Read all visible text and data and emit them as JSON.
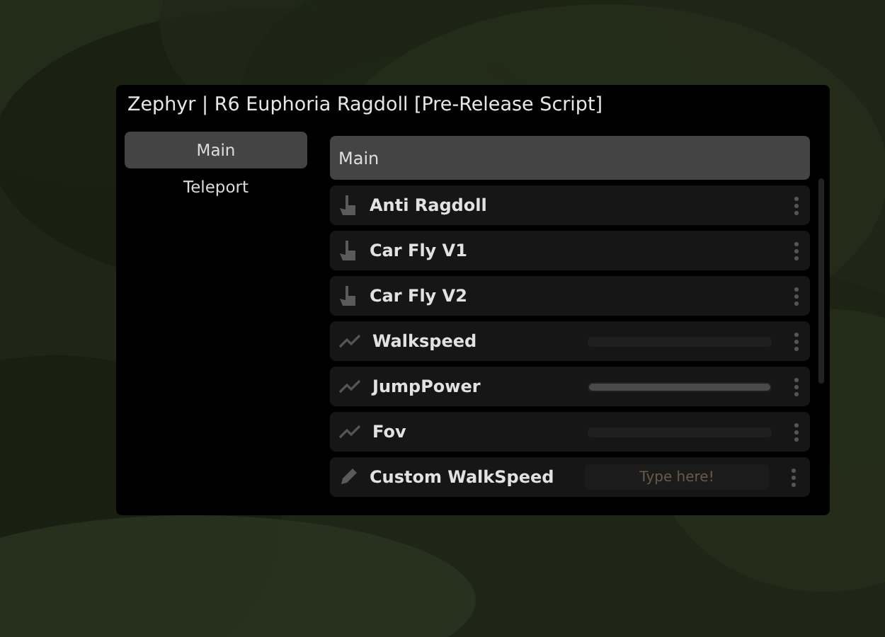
{
  "window": {
    "title": "Zephyr | R6 Euphoria Ragdoll [Pre-Release Script]"
  },
  "tabs": [
    {
      "label": "Main",
      "selected": true
    },
    {
      "label": "Teleport",
      "selected": false
    }
  ],
  "section": {
    "title": "Main"
  },
  "items": [
    {
      "kind": "button",
      "label": "Anti Ragdoll"
    },
    {
      "kind": "button",
      "label": "Car Fly V1"
    },
    {
      "kind": "button",
      "label": "Car Fly V2"
    },
    {
      "kind": "slider",
      "label": "Walkspeed",
      "level": 0
    },
    {
      "kind": "slider",
      "label": "JumpPower",
      "level": 1
    },
    {
      "kind": "slider",
      "label": "Fov",
      "level": 0
    },
    {
      "kind": "input",
      "label": "Custom WalkSpeed",
      "placeholder": "Type here!"
    }
  ]
}
